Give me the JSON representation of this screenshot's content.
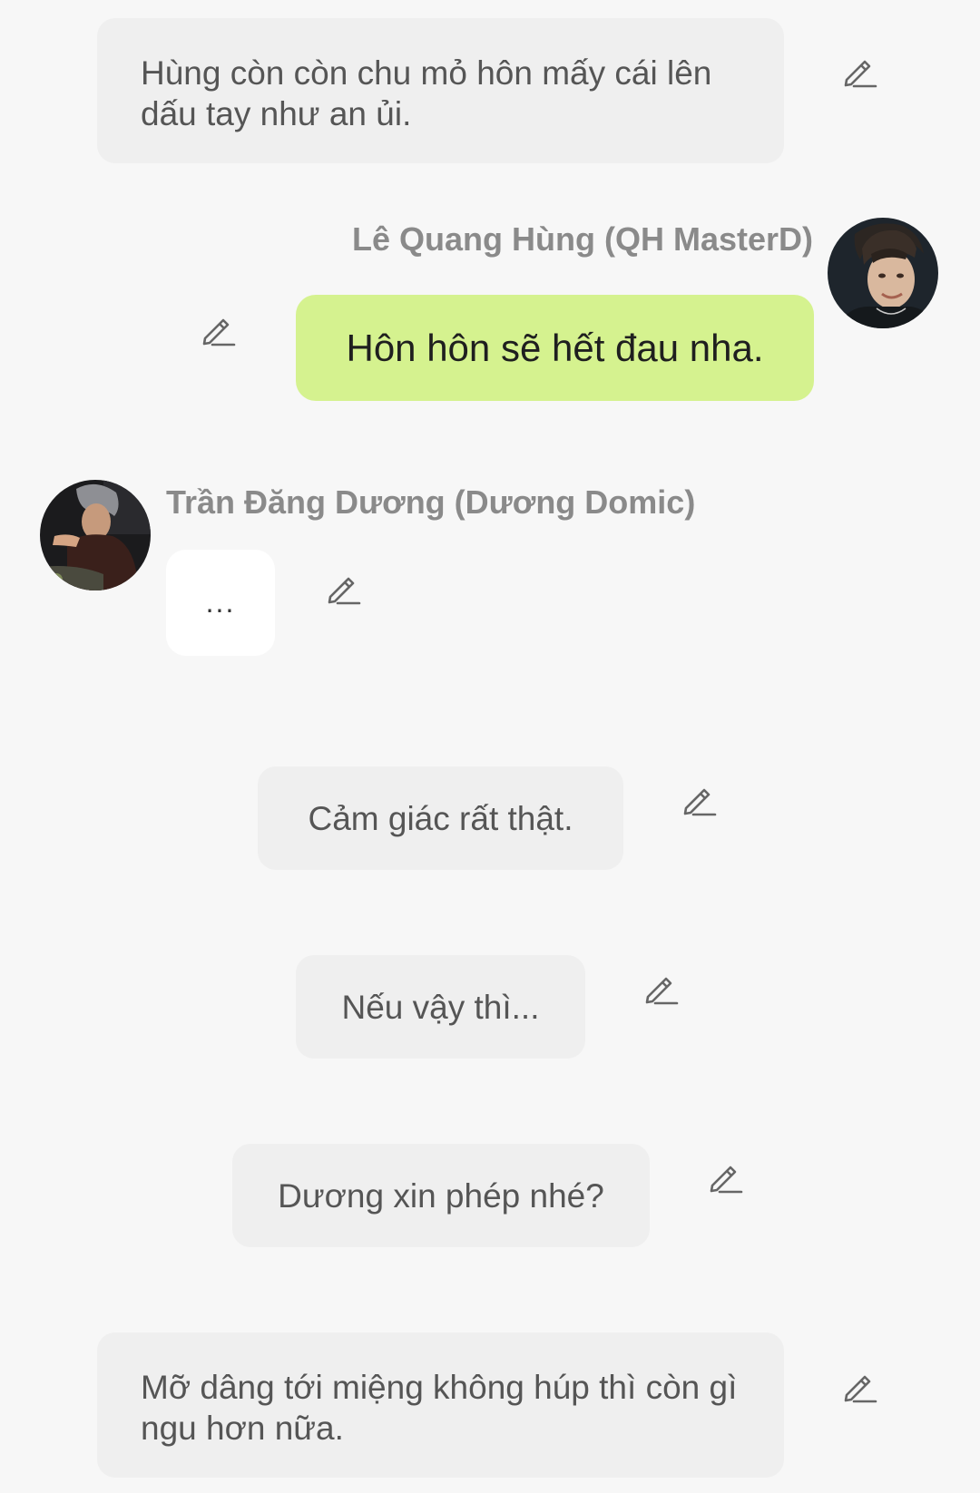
{
  "messages": {
    "narration_1": "Hùng còn còn chu mỏ hôn mấy cái lên dấu tay như an ủi.",
    "hung_name": "Lê Quang Hùng (QH MasterD)",
    "hung_message": "Hôn hôn sẽ hết đau nha.",
    "duong_name": "Trần Đăng Dương (Dương Domic)",
    "duong_message": "...",
    "narration_2": "Cảm giác rất thật.",
    "narration_3": "Nếu vậy thì...",
    "narration_4": "Dương xin phép nhé?",
    "narration_5": "Mỡ dâng tới miệng không húp thì còn gì ngu hơn nữa."
  },
  "icons": {
    "edit": "pencil-edit-icon",
    "avatar_hung": "avatar-photo",
    "avatar_duong": "avatar-photo"
  },
  "colors": {
    "background": "#f7f7f7",
    "narration_bubble": "#efefef",
    "outgoing_bubble": "#d5f28f",
    "incoming_bubble": "#ffffff",
    "name_text": "#8a8a8a"
  }
}
